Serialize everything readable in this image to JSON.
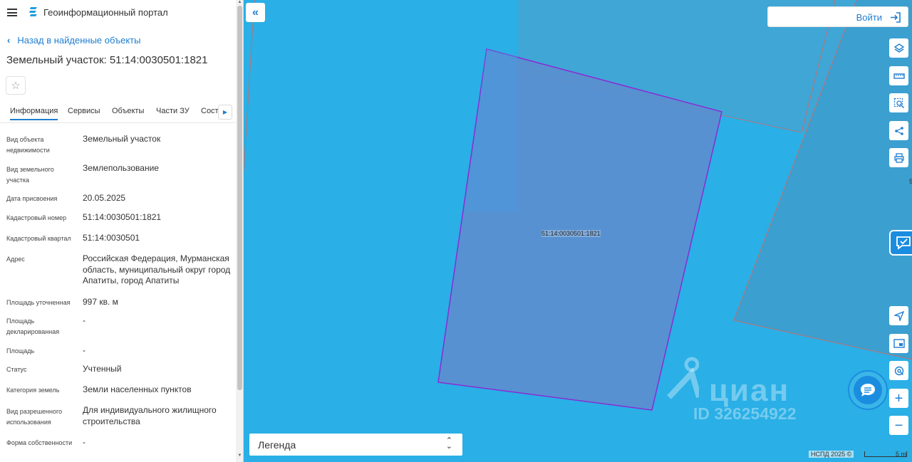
{
  "header": {
    "app_title": "Геоинформационный портал"
  },
  "back_link": "Назад в найденные объекты",
  "object_title": "Земельный участок: 51:14:0030501:1821",
  "tabs": [
    {
      "label": "Информация"
    },
    {
      "label": "Сервисы"
    },
    {
      "label": "Объекты"
    },
    {
      "label": "Части ЗУ"
    },
    {
      "label": "Соста"
    }
  ],
  "attributes": [
    {
      "label": "Вид объекта недвижимости",
      "value": "Земельный участок"
    },
    {
      "label": "Вид земельного участка",
      "value": "Землепользование"
    },
    {
      "label": "Дата присвоения",
      "value": "20.05.2025"
    },
    {
      "label": "Кадастровый номер",
      "value": "51:14:0030501:1821"
    },
    {
      "label": "Кадастровый квартал",
      "value": "51:14:0030501"
    },
    {
      "label": "Адрес",
      "value": "Российская Федерация, Мурманская область, муниципальный округ город Апатиты, город Апатиты"
    },
    {
      "label": "Площадь уточненная",
      "value": "997 кв. м"
    },
    {
      "label": "Площадь декларированная",
      "value": "-"
    },
    {
      "label": "Площадь",
      "value": "-"
    },
    {
      "label": "Статус",
      "value": "Учтенный"
    },
    {
      "label": "Категория земель",
      "value": "Земли населенных пунктов"
    },
    {
      "label": "Вид разрешенного использования",
      "value": "Для индивидуального жилищного строительства"
    },
    {
      "label": "Форма собственности",
      "value": "-"
    }
  ],
  "map": {
    "login_label": "Войти",
    "parcel_label": "51:14:0030501:1821",
    "legend_label": "Легенда",
    "watermark_brand": "циан",
    "watermark_id": "ID 326254922",
    "attribution": "НСПД 2025 ©",
    "scale_label": "5 m",
    "edge_number": "5",
    "colors": {
      "water": "#2aafe6",
      "parcel_fill": "#5a8fd0",
      "parcel_border": "#8a2bd6",
      "accent": "#1f7ed1"
    }
  },
  "icons": [
    "menu-icon",
    "logo-icon",
    "chevron-left-icon",
    "star-icon",
    "chevron-right-icon",
    "double-chevron-left-icon",
    "login-icon",
    "layers-icon",
    "ruler-icon",
    "select-area-icon",
    "share-icon",
    "print-icon",
    "feedback-icon",
    "locate-icon",
    "minimap-icon",
    "geo-search-icon",
    "zoom-in-icon",
    "zoom-out-icon",
    "chat-icon"
  ]
}
